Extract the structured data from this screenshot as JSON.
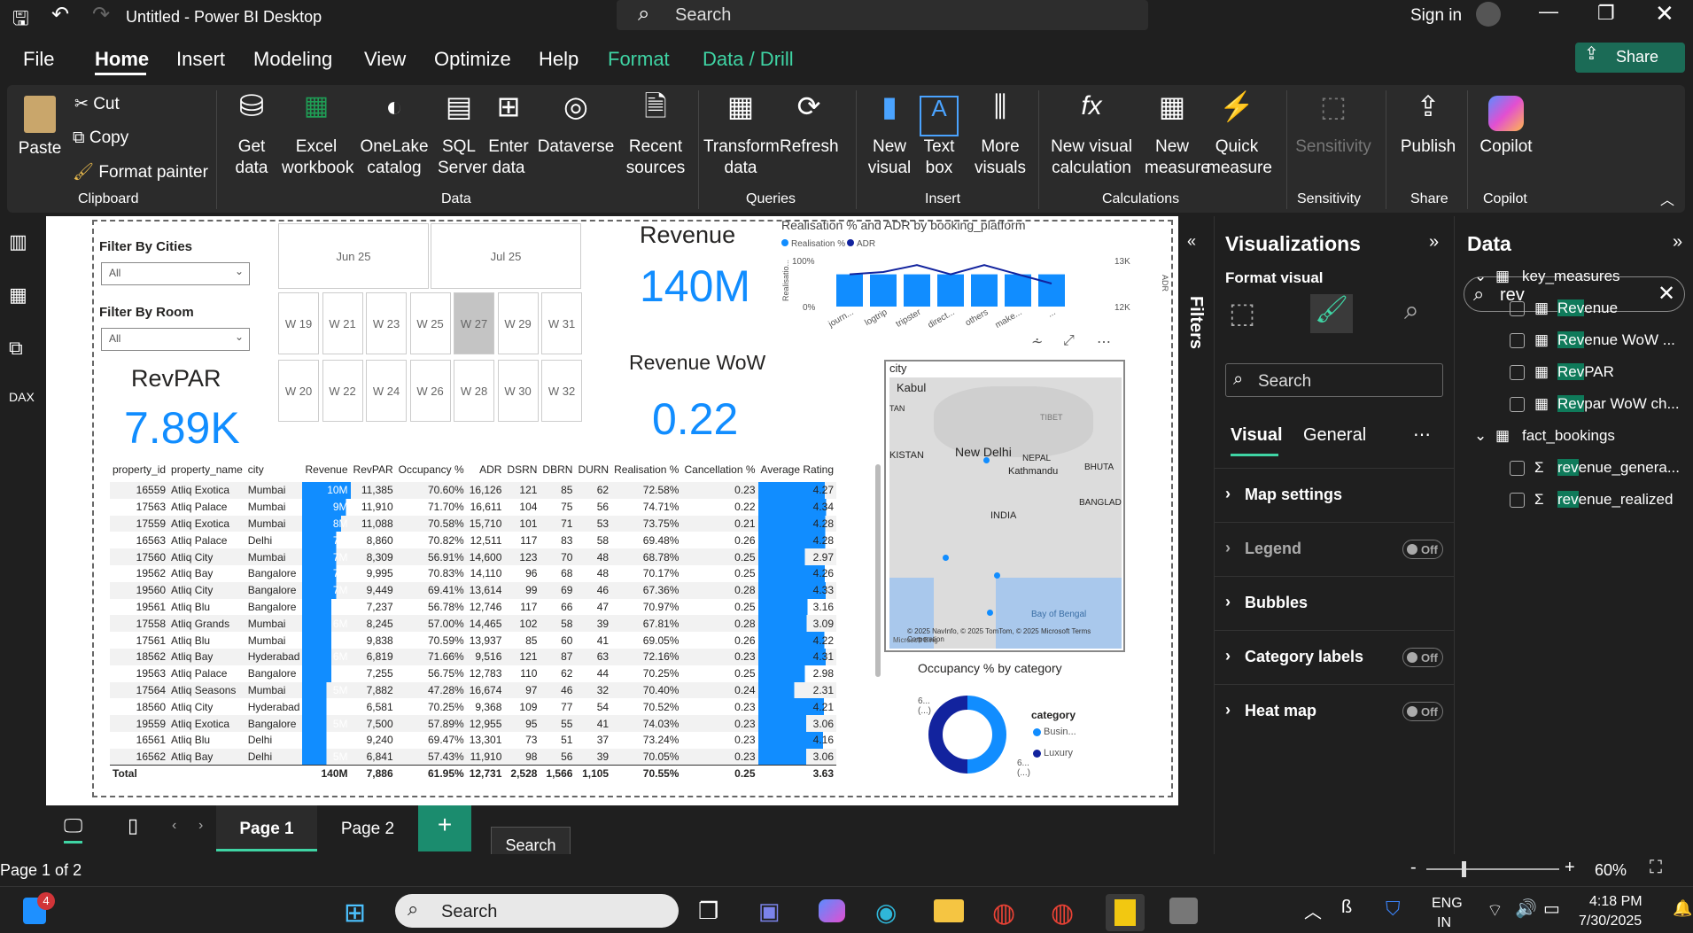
{
  "app": {
    "title": "Untitled - Power BI Desktop",
    "search": "Search",
    "sign_in": "Sign in",
    "share": "Share"
  },
  "menu": [
    "File",
    "Home",
    "Insert",
    "Modeling",
    "View",
    "Optimize",
    "Help",
    "Format",
    "Data / Drill"
  ],
  "ribbon": {
    "paste": "Paste",
    "cut": "Cut",
    "copy": "Copy",
    "format_painter": "Format painter",
    "clipboard": "Clipboard",
    "get_data": "Get data",
    "excel": "Excel workbook",
    "onelake": "OneLake catalog",
    "sql": "SQL Server",
    "enter_data": "Enter data",
    "dataverse": "Dataverse",
    "recent": "Recent sources",
    "data_group": "Data",
    "transform": "Transform data",
    "refresh": "Refresh",
    "queries": "Queries",
    "new_visual": "New visual",
    "text_box": "Text box",
    "more_visuals": "More visuals",
    "insert": "Insert",
    "new_visual_calc": "New visual calculation",
    "new_measure": "New measure",
    "quick_measure": "Quick measure",
    "calculations": "Calculations",
    "sensitivity": "Sensitivity",
    "sensitivity_group": "Sensitivity",
    "publish": "Publish",
    "share_group": "Share",
    "copilot": "Copilot",
    "copilot_group": "Copilot"
  },
  "report": {
    "filter_cities": "Filter By Cities",
    "filter_room": "Filter By Room",
    "all": "All",
    "months": [
      "Jun 25",
      "Jul 25"
    ],
    "weeks_row1": [
      "W 19",
      "W 21",
      "W 23",
      "W 25",
      "W 27",
      "W 29",
      "W 31"
    ],
    "weeks_row2": [
      "W 20",
      "W 22",
      "W 24",
      "W 26",
      "W 28",
      "W 30",
      "W 32"
    ],
    "revpar_label": "RevPAR",
    "revpar_value": "7.89K",
    "revenue_label": "Revenue",
    "revenue_value": "140M",
    "wow_label": "Revenue WoW",
    "wow_value": "0.22",
    "combo_title": "Realisation % and ADR by booking_platform",
    "combo_legend": [
      "Realisation %",
      "ADR"
    ],
    "combo_y_left": [
      "100%",
      "0%"
    ],
    "combo_y_right": [
      "13K",
      "12K"
    ],
    "combo_y_left_title": "Realisatio...",
    "combo_y_right_title": "ADR",
    "combo_categories": [
      "journ...",
      "logtrip",
      "tripster",
      "direct...",
      "others",
      "make...",
      "..."
    ],
    "map_title": "city",
    "map_labels": [
      "Kabul",
      "TAN",
      "KISTAN",
      "New Delhi",
      "NEPAL",
      "Kathmandu",
      "BHUTA",
      "TIBET",
      "INDIA",
      "BANGLADE",
      "Bay of Bengal"
    ],
    "map_credit": "© 2025 NavInfo, © 2025 TomTom, © 2025 Microsoft Terms Corporation",
    "map_bing": "Microsoft Bing",
    "donut_title": "Occupancy % by category",
    "donut_legend_title": "category",
    "donut_legend": [
      "Busin...",
      "Luxury"
    ],
    "donut_labels": [
      "6... (...)",
      "6... (...)"
    ],
    "table_headers": [
      "property_id",
      "property_name",
      "city",
      "Revenue",
      "RevPAR",
      "Occupancy %",
      "ADR",
      "DSRN",
      "DBRN",
      "DURN",
      "Realisation %",
      "Cancellation %",
      "Average Rating"
    ],
    "table_rows": [
      [
        "16559",
        "Atliq Exotica",
        "Mumbai",
        "10M",
        "11,385",
        "70.60%",
        "16,126",
        "121",
        "85",
        "62",
        "72.58%",
        "0.23",
        "4.27"
      ],
      [
        "17563",
        "Atliq Palace",
        "Mumbai",
        "9M",
        "11,910",
        "71.70%",
        "16,611",
        "104",
        "75",
        "56",
        "74.71%",
        "0.22",
        "4.34"
      ],
      [
        "17559",
        "Atliq Exotica",
        "Mumbai",
        "8M",
        "11,088",
        "70.58%",
        "15,710",
        "101",
        "71",
        "53",
        "73.75%",
        "0.21",
        "4.28"
      ],
      [
        "16563",
        "Atliq Palace",
        "Delhi",
        "7M",
        "8,860",
        "70.82%",
        "12,511",
        "117",
        "83",
        "58",
        "69.48%",
        "0.26",
        "4.28"
      ],
      [
        "17560",
        "Atliq City",
        "Mumbai",
        "7M",
        "8,309",
        "56.91%",
        "14,600",
        "123",
        "70",
        "48",
        "68.78%",
        "0.25",
        "2.97"
      ],
      [
        "19562",
        "Atliq Bay",
        "Bangalore",
        "7M",
        "9,995",
        "70.83%",
        "14,110",
        "96",
        "68",
        "48",
        "70.17%",
        "0.25",
        "4.26"
      ],
      [
        "19560",
        "Atliq City",
        "Bangalore",
        "7M",
        "9,449",
        "69.41%",
        "13,614",
        "99",
        "69",
        "46",
        "67.36%",
        "0.28",
        "4.33"
      ],
      [
        "19561",
        "Atliq Blu",
        "Bangalore",
        "6M",
        "7,237",
        "56.78%",
        "12,746",
        "117",
        "66",
        "47",
        "70.97%",
        "0.25",
        "3.16"
      ],
      [
        "17558",
        "Atliq Grands",
        "Mumbai",
        "6M",
        "8,245",
        "57.00%",
        "14,465",
        "102",
        "58",
        "39",
        "67.81%",
        "0.28",
        "3.09"
      ],
      [
        "17561",
        "Atliq Blu",
        "Mumbai",
        "6M",
        "9,838",
        "70.59%",
        "13,937",
        "85",
        "60",
        "41",
        "69.05%",
        "0.26",
        "4.22"
      ],
      [
        "18562",
        "Atliq Bay",
        "Hyderabad",
        "6M",
        "6,819",
        "71.66%",
        "9,516",
        "121",
        "87",
        "63",
        "72.16%",
        "0.23",
        "4.31"
      ],
      [
        "19563",
        "Atliq Palace",
        "Bangalore",
        "6M",
        "7,255",
        "56.75%",
        "12,783",
        "110",
        "62",
        "44",
        "70.25%",
        "0.25",
        "2.98"
      ],
      [
        "17564",
        "Atliq Seasons",
        "Mumbai",
        "5M",
        "7,882",
        "47.28%",
        "16,674",
        "97",
        "46",
        "32",
        "70.40%",
        "0.24",
        "2.31"
      ],
      [
        "18560",
        "Atliq City",
        "Hyderabad",
        "5M",
        "6,581",
        "70.25%",
        "9,368",
        "109",
        "77",
        "54",
        "70.52%",
        "0.23",
        "4.21"
      ],
      [
        "19559",
        "Atliq Exotica",
        "Bangalore",
        "5M",
        "7,500",
        "57.89%",
        "12,955",
        "95",
        "55",
        "41",
        "74.03%",
        "0.23",
        "3.06"
      ],
      [
        "16561",
        "Atliq Blu",
        "Delhi",
        "5M",
        "9,240",
        "69.47%",
        "13,301",
        "73",
        "51",
        "37",
        "73.24%",
        "0.23",
        "4.16"
      ],
      [
        "16562",
        "Atliq Bay",
        "Delhi",
        "5M",
        "6,841",
        "57.43%",
        "11,910",
        "98",
        "56",
        "39",
        "70.05%",
        "0.23",
        "3.06"
      ]
    ],
    "table_total": [
      "Total",
      "",
      "",
      "140M",
      "7,886",
      "61.95%",
      "12,731",
      "2,528",
      "1,566",
      "1,105",
      "70.55%",
      "0.25",
      "3.63"
    ]
  },
  "chart_data": [
    {
      "type": "bar",
      "title": "Realisation % and ADR by booking_platform",
      "categories": [
        "journ...",
        "logtrip",
        "tripster",
        "direct...",
        "others",
        "make...",
        "..."
      ],
      "series": [
        {
          "name": "Realisation %",
          "values": [
            70,
            70,
            70,
            70,
            70,
            70,
            70
          ]
        },
        {
          "name": "ADR",
          "values": [
            12700,
            12750,
            12900,
            12700,
            12900,
            12700,
            12500
          ]
        }
      ],
      "ylim": [
        0,
        100
      ],
      "y2lim": [
        12000,
        13000
      ]
    },
    {
      "type": "pie",
      "title": "Occupancy % by category",
      "categories": [
        "Busin...",
        "Luxury"
      ],
      "values": [
        60,
        60
      ]
    }
  ],
  "visualizations": {
    "title": "Visualizations",
    "format_visual": "Format visual",
    "search": "Search",
    "tab_visual": "Visual",
    "tab_general": "General",
    "sections": [
      {
        "label": "Map settings",
        "toggle": ""
      },
      {
        "label": "Legend",
        "toggle": "Off"
      },
      {
        "label": "Bubbles",
        "toggle": ""
      },
      {
        "label": "Category labels",
        "toggle": "Off"
      },
      {
        "label": "Heat map",
        "toggle": "Off"
      }
    ]
  },
  "data_pane": {
    "title": "Data",
    "search": "rev",
    "tables": [
      {
        "name": "key_measures",
        "fields": [
          "Revenue",
          "Revenue WoW ...",
          "RevPAR",
          "Revpar WoW ch..."
        ]
      },
      {
        "name": "fact_bookings",
        "fields": [
          "revenue_genera...",
          "revenue_realized"
        ]
      }
    ]
  },
  "filters_label": "Filters",
  "pages": [
    "Page 1",
    "Page 2"
  ],
  "tooltip": "Search",
  "status": {
    "page": "Page 1 of 2",
    "zoom": "60%"
  },
  "taskbar": {
    "search": "Search",
    "badge": "4",
    "lang": "ENG",
    "region": "IN",
    "time": "4:18 PM",
    "date": "7/30/2025"
  },
  "colors": {
    "accent": "#118dff",
    "ribbon": "#2b2b2b",
    "format_tab": "#3fd4a4",
    "dark_blue": "#12239e"
  }
}
